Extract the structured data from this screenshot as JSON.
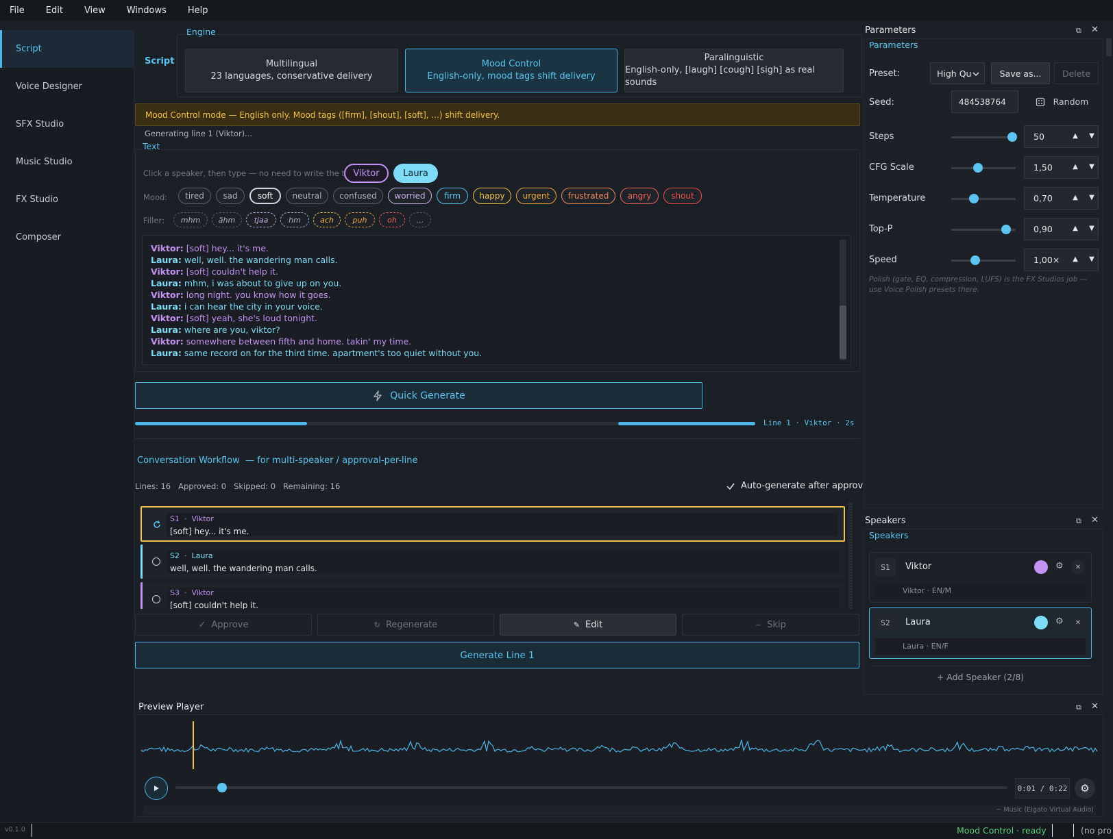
{
  "menu": [
    "File",
    "Edit",
    "View",
    "Windows",
    "Help"
  ],
  "sidebar": {
    "items": [
      {
        "label": "Script",
        "active": true
      },
      {
        "label": "Voice Designer"
      },
      {
        "label": "SFX Studio"
      },
      {
        "label": "Music Studio"
      },
      {
        "label": "FX Studio"
      },
      {
        "label": "Composer"
      }
    ]
  },
  "script": {
    "tab_label": "Script",
    "engine_label": "Engine",
    "engines": [
      {
        "title": "Multilingual",
        "sub": "23 languages, conservative delivery"
      },
      {
        "title": "Mood Control",
        "sub": "English-only, mood tags shift delivery"
      },
      {
        "title": "Paralinguistic",
        "sub": "English-only, [laugh] [cough] [sigh] as real sounds"
      }
    ],
    "banner": "Mood Control mode — English only. Mood tags ([firm], [shout], [soft], ...) shift delivery.",
    "status": "Generating line 1 (Viktor)...",
    "text_label": "Text",
    "speaker_hint": "Click a speaker, then type — no need to write the tag:",
    "speakers": [
      "Viktor",
      "Laura"
    ],
    "mood_label": "Mood:",
    "moods": [
      {
        "label": "tired",
        "color": "#aeb4bc"
      },
      {
        "label": "sad",
        "color": "#aeb4bc"
      },
      {
        "label": "soft",
        "color": "#ffffff"
      },
      {
        "label": "neutral",
        "color": "#aeb4bc"
      },
      {
        "label": "confused",
        "color": "#aeb4bc"
      },
      {
        "label": "worried",
        "color": "#c9b0ea"
      },
      {
        "label": "firm",
        "color": "#5cc4f0"
      },
      {
        "label": "happy",
        "color": "#f2c14e"
      },
      {
        "label": "urgent",
        "color": "#f0a640"
      },
      {
        "label": "frustrated",
        "color": "#f08a5a"
      },
      {
        "label": "angry",
        "color": "#f0625a"
      },
      {
        "label": "shout",
        "color": "#f0504a"
      }
    ],
    "filler_label": "Filler:",
    "fillers": [
      {
        "label": "mhm",
        "color": "#aeb4bc"
      },
      {
        "label": "ähm",
        "color": "#aeb4bc"
      },
      {
        "label": "tjaa",
        "color": "#c9b0ea"
      },
      {
        "label": "hm",
        "color": "#9fb8c9"
      },
      {
        "label": "ach",
        "color": "#f2c14e"
      },
      {
        "label": "puh",
        "color": "#f0a640"
      },
      {
        "label": "oh",
        "color": "#f0625a"
      },
      {
        "label": "...",
        "color": "#aeb4bc"
      }
    ],
    "lines": [
      {
        "speaker": "Viktor",
        "tag": "[soft]",
        "text": " hey... it's me."
      },
      {
        "speaker": "Laura",
        "tag": "",
        "text": " well, well. the wandering man calls."
      },
      {
        "speaker": "Viktor",
        "tag": "[soft]",
        "text": " couldn't help it."
      },
      {
        "speaker": "Laura",
        "tag": "",
        "text": " mhm, i was about to give up on you."
      },
      {
        "speaker": "Viktor",
        "tag": "",
        "text": " long night. you know how it goes."
      },
      {
        "speaker": "Laura",
        "tag": "",
        "text": " i can hear the city in your voice."
      },
      {
        "speaker": "Viktor",
        "tag": "[soft]",
        "text": " yeah, she's loud tonight."
      },
      {
        "speaker": "Laura",
        "tag": "",
        "text": " where are you, viktor?"
      },
      {
        "speaker": "Viktor",
        "tag": "",
        "text": " somewhere between fifth and home. takin' my time."
      },
      {
        "speaker": "Laura",
        "tag": "",
        "text": " same record on for the third time. apartment's too quiet without you."
      }
    ],
    "quick_generate": "Quick Generate",
    "progress_label": "Line 1 · Viktor · 2s",
    "progress_fraction": 0.38
  },
  "workflow": {
    "title": "Conversation Workflow",
    "subtitle": "—  for multi-speaker / approval-per-line",
    "stats": {
      "lines": "Lines: 16",
      "approved": "Approved: 0",
      "skipped": "Skipped: 0",
      "remaining": "Remaining: 16"
    },
    "auto_generate": "Auto-generate after approve",
    "rows": [
      {
        "id": "S1",
        "sep": "·",
        "speaker": "Viktor",
        "text": "[soft] hey... it's me."
      },
      {
        "id": "S2",
        "sep": "·",
        "speaker": "Laura",
        "text": "well, well. the wandering man calls."
      },
      {
        "id": "S3",
        "sep": "·",
        "speaker": "Viktor",
        "text": "[soft] couldn't help it."
      }
    ],
    "actions": {
      "approve": "Approve",
      "regenerate": "Regenerate",
      "edit": "Edit",
      "skip": "Skip"
    },
    "generate_line": "Generate Line 1"
  },
  "parameters": {
    "dock_title": "Parameters",
    "section_label": "Parameters",
    "preset_label": "Preset:",
    "preset_value": "High Qu",
    "save_as": "Save as...",
    "delete": "Delete",
    "seed_label": "Seed:",
    "seed_value": "484538764",
    "random": "Random",
    "sliders": [
      {
        "label": "Steps",
        "value": "50",
        "fraction": 0.95
      },
      {
        "label": "CFG Scale",
        "value": "1,50",
        "fraction": 0.42
      },
      {
        "label": "Temperature",
        "value": "0,70",
        "fraction": 0.35
      },
      {
        "label": "Top-P",
        "value": "0,90",
        "fraction": 0.85
      },
      {
        "label": "Speed",
        "value": "1,00×",
        "fraction": 0.37
      }
    ],
    "note": "Polish (gate, EQ, compression, LUFS) is the FX Studios job — use Voice Polish presets there."
  },
  "speakers_panel": {
    "dock_title": "Speakers",
    "section_label": "Speakers",
    "items": [
      {
        "id": "S1",
        "name": "Viktor",
        "sub": "Viktor · EN/M",
        "color": "#c392f2"
      },
      {
        "id": "S2",
        "name": "Laura",
        "sub": "Laura · EN/F",
        "color": "#7fdcf6"
      }
    ],
    "add": "+  Add Speaker  (2/8)"
  },
  "player": {
    "title": "Preview Player",
    "time": "0:01 / 0:22",
    "position_fraction": 0.056,
    "device": "~ Music (Elgato Virtual Audio)"
  },
  "statusbar": {
    "version": "v0.1.0",
    "mode": "Mood Control · ready",
    "project": "(no pro"
  },
  "colors": {
    "accent": "#4fb6e8",
    "viktor": "#c392f2",
    "laura": "#7fdcf6",
    "banner_text": "#f2c14e"
  }
}
